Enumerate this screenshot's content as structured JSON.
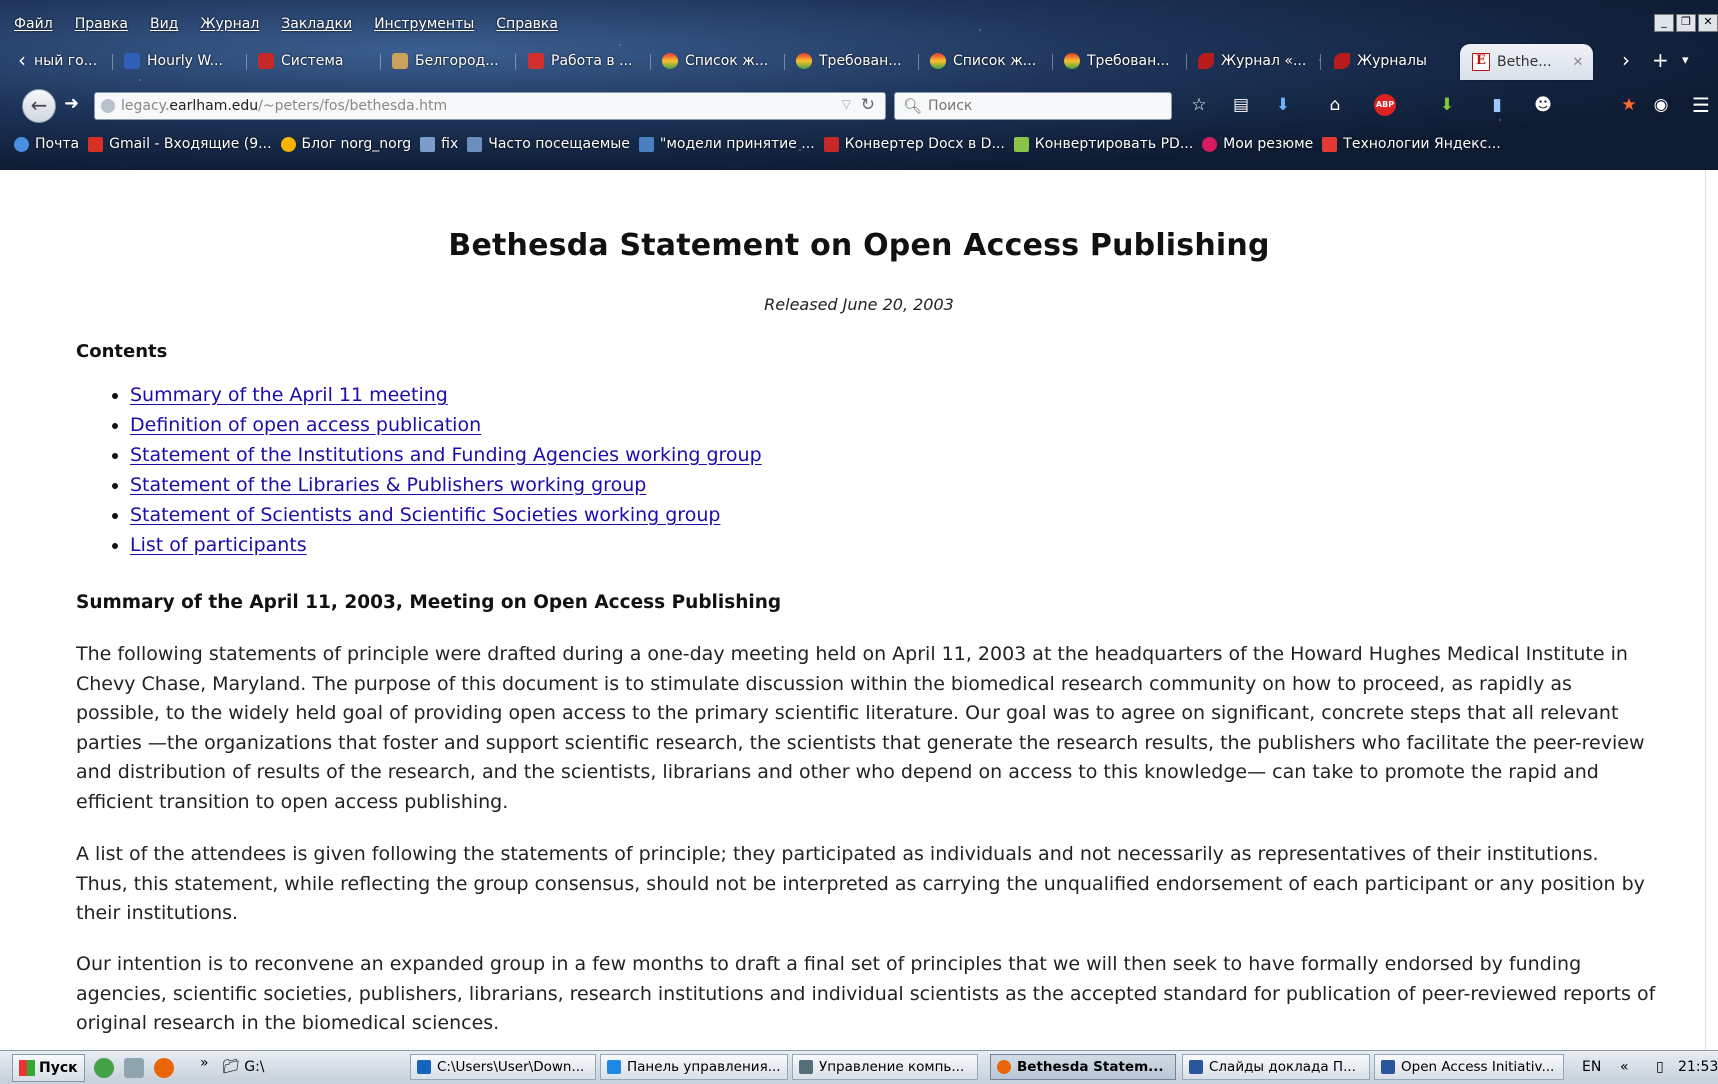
{
  "menu": [
    "Файл",
    "Правка",
    "Вид",
    "Журнал",
    "Закладки",
    "Инструменты",
    "Справка"
  ],
  "tabs": [
    {
      "label": "ный го...",
      "color": "#3b6fd1"
    },
    {
      "label": "Hourly W...",
      "color": "#2f5fb8"
    },
    {
      "label": "Система",
      "color": "#c62828"
    },
    {
      "label": "Белгород...",
      "color": "#c8a15a"
    },
    {
      "label": "Работа в ...",
      "color": "#d32f2f"
    },
    {
      "label": "Список ж...",
      "color": "#e65100"
    },
    {
      "label": "Требован...",
      "color": "#e65100"
    },
    {
      "label": "Список ж...",
      "color": "#e65100"
    },
    {
      "label": "Требован...",
      "color": "#e65100"
    },
    {
      "label": "Журнал «...",
      "color": "#b71c1c"
    },
    {
      "label": "Журналы",
      "color": "#b71c1c"
    },
    {
      "label": "Bethe...",
      "favicon_letter": "E",
      "active": true
    }
  ],
  "navbar": {
    "url_prefix": "legacy.",
    "url_domain": "earlham.edu",
    "url_path": "/~peters/fos/bethesda.htm",
    "search_placeholder": "Поиск"
  },
  "bookmarks": [
    {
      "label": "Почта",
      "color": "#4a90e2"
    },
    {
      "label": "Gmail - Входящие (9...",
      "color": "#d93025"
    },
    {
      "label": "Блог norg_norg",
      "color": "#f5b400"
    },
    {
      "label": "fix",
      "color": "#7b9ccc"
    },
    {
      "label": "Часто посещаемые",
      "color": "#6c8ebf"
    },
    {
      "label": "\"модели принятие ...",
      "color": "#4a7fc1"
    },
    {
      "label": "Конвертер Docx в D...",
      "color": "#c62828"
    },
    {
      "label": "Конвертировать PD...",
      "color": "#8bc34a"
    },
    {
      "label": "Мои резюме",
      "color": "#d81b60"
    },
    {
      "label": "Технологии Яндекс...",
      "color": "#e53935"
    }
  ],
  "page": {
    "title": "Bethesda Statement on Open Access Publishing",
    "released": "Released June 20, 2003",
    "contents_heading": "Contents",
    "toc": [
      "Summary of the April 11 meeting",
      "Definition of open access publication",
      "Statement of the Institutions and Funding Agencies working group",
      "Statement of the Libraries & Publishers working group",
      "Statement of Scientists and Scientific Societies working group",
      "List of participants"
    ],
    "summary_heading": "Summary of the April 11, 2003, Meeting on Open Access Publishing",
    "paragraphs": [
      "The following statements of principle were drafted during a one-day meeting held on April 11, 2003 at the headquarters of the Howard Hughes Medical Institute in Chevy Chase, Maryland. The purpose of this document is to stimulate discussion within the biomedical research community on how to proceed, as rapidly as possible, to the widely held goal of providing open access to the primary scientific literature. Our goal was to agree on significant, concrete steps that all relevant parties —the organizations that foster and support scientific research, the scientists that generate the research results, the publishers who facilitate the peer-review and distribution of results of the research, and the scientists, librarians and other who depend on access to this knowledge— can take to promote the rapid and efficient transition to open access publishing.",
      "A list of the attendees is given following the statements of principle; they participated as individuals and not necessarily as representatives of their institutions. Thus, this statement, while reflecting the group consensus, should not be interpreted as carrying the unqualified endorsement of each participant or any position by their institutions.",
      "Our intention is to reconvene an expanded group in a few months to draft a final set of principles that we will then seek to have formally endorsed by funding agencies, scientific societies, publishers, librarians, research institutions and individual scientists as the accepted standard for publication of peer-reviewed reports of original research in the biomedical sciences."
    ]
  },
  "taskbar": {
    "start_label": "Пуск",
    "overflow": "»",
    "drive": "G:\\",
    "buttons": [
      {
        "label": "C:\\Users\\User\\Down...",
        "color": "#1565c0"
      },
      {
        "label": "Панель управления...",
        "color": "#1e88e5"
      },
      {
        "label": "Управление компь...",
        "color": "#546e7a"
      },
      {
        "label": "Bethesda Statem...",
        "color": "#e8650a",
        "active": true
      },
      {
        "label": "Слайды доклада П...",
        "color": "#2b579a"
      },
      {
        "label": "Open Access Initiativ...",
        "color": "#2b579a"
      }
    ],
    "lang": "EN",
    "collapse": "«",
    "clock": "21:53"
  }
}
